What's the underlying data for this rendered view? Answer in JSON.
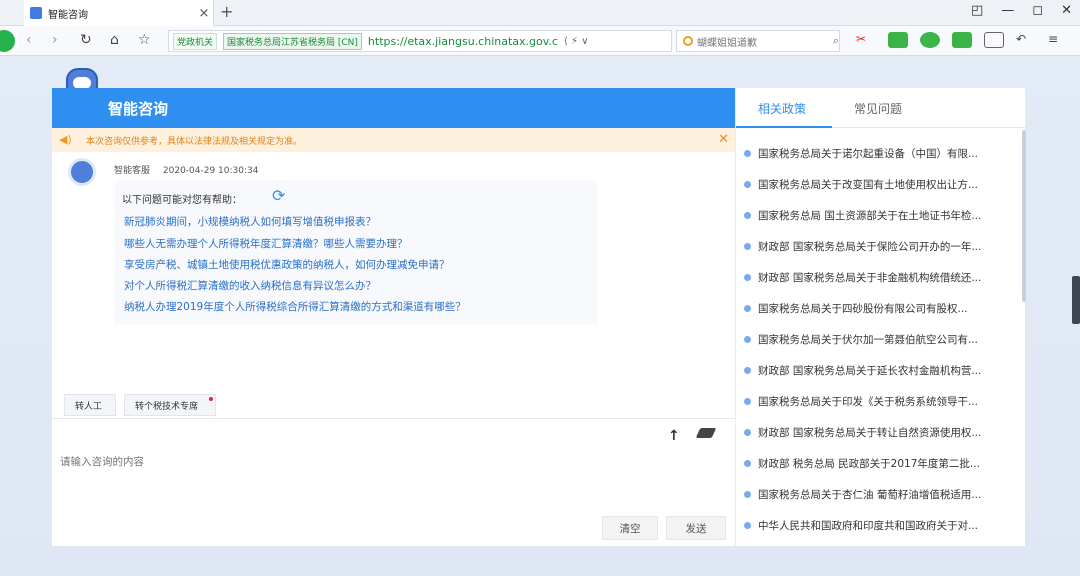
{
  "browser": {
    "tab_title": "智能咨询",
    "tab_close": "×",
    "new_tab": "+",
    "badge_gov": "党政机关",
    "badge_cert": "国家税务总局江苏省税务局 [CN]",
    "url": "https://etax.jiangsu.chinatax.gov.cn",
    "url_tools": "⟨ ⚡ ∨",
    "search_text": "蝴蝶姐姐道歉",
    "controls": {
      "restore": "◰",
      "minimize": "—",
      "maximize": "◻",
      "close": "✕"
    }
  },
  "chat": {
    "title": "智能咨询",
    "notice": "本次咨询仅供参考，具体以法律法规及相关规定为准。",
    "bot_name": "智能客服",
    "timestamp": "2020-04-29 10:30:34",
    "intro": "以下问题可能对您有帮助：",
    "questions": [
      "新冠肺炎期间，小规模纳税人如何填写增值税申报表？",
      "哪些人无需办理个人所得税年度汇算清缴？哪些人需要办理？",
      "享受房产税、城镇土地使用税优惠政策的纳税人，如何办理减免申请？",
      "对个人所得税汇算清缴的收入纳税信息有异议怎么办？",
      "纳税人办理2019年度个人所得税综合所得汇算清缴的方式和渠道有哪些？"
    ],
    "quick_buttons": {
      "transfer": "转人工",
      "expert": "转个税技术专席"
    },
    "input_placeholder": "请输入咨询的内容",
    "clear_label": "清空",
    "send_label": "发送"
  },
  "side": {
    "tab_policy": "相关政策",
    "tab_faq": "常见问题",
    "policies": [
      "国家税务总局关于诺尔起重设备（中国）有限...",
      "国家税务总局关于改变国有土地使用权出让方...",
      "国家税务总局 国土资源部关于在土地证书年检...",
      "财政部 国家税务总局关于保险公司开办的一年...",
      "财政部 国家税务总局关于非金融机构统借统还...",
      "国家税务总局关于四砂股份有限公司有股权...",
      "国家税务总局关于伏尔加一第聂伯航空公司有...",
      "财政部 国家税务总局关于延长农村金融机构营...",
      "国家税务总局关于印发《关于税务系统领导干...",
      "财政部 国家税务总局关于转让自然资源使用权...",
      "财政部 税务总局 民政部关于2017年度第二批...",
      "国家税务总局关于杏仁油 葡萄籽油增值税适用...",
      "中华人民共和国政府和印度共和国政府关于对..."
    ]
  }
}
